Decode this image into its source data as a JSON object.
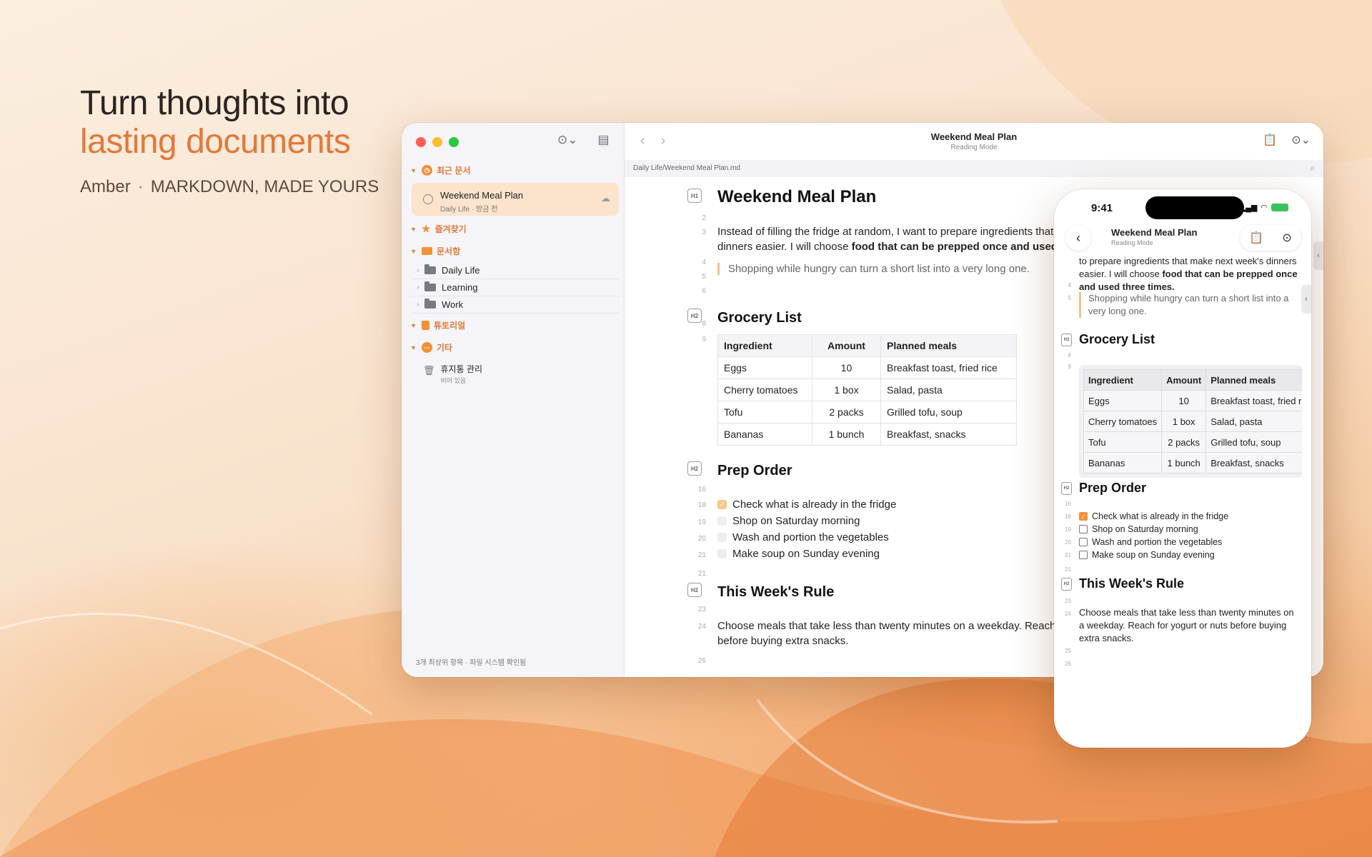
{
  "hero": {
    "line1": "Turn thoughts into",
    "line2": "lasting documents",
    "brand": "Amber",
    "sep": "·",
    "tagline": "MARKDOWN, MADE YOURS"
  },
  "sidebar": {
    "recent_label": "최근 문서",
    "recent_doc": {
      "title": "Weekend Meal Plan",
      "meta": "Daily Life · 방금 전"
    },
    "favorites_label": "즐겨찾기",
    "library_label": "문서함",
    "folders": [
      "Daily Life",
      "Learning",
      "Work"
    ],
    "tutorial_label": "튜토리얼",
    "other_label": "기타",
    "trash": {
      "title": "휴지통 관리",
      "sub": "비어 있음"
    },
    "footer": "3개 최상위 항목 · 파일 시스템 확인됨"
  },
  "toolbar": {
    "title": "Weekend Meal Plan",
    "mode": "Reading Mode"
  },
  "path": "Daily Life/Weekend Meal Plan.md",
  "doc": {
    "title": "Weekend Meal Plan",
    "intro_a": "Instead of filling the fridge at random, I want to prepare ingredients that make next week's dinners easier. I will choose ",
    "intro_bold": "food that can be prepped once and used three times.",
    "quote": "Shopping while hungry can turn a short list into a very long one.",
    "grocery_heading": "Grocery List",
    "table_headers": [
      "Ingredient",
      "Amount",
      "Planned meals"
    ],
    "table_rows": [
      [
        "Eggs",
        "10",
        "Breakfast toast, fried rice"
      ],
      [
        "Cherry tomatoes",
        "1 box",
        "Salad, pasta"
      ],
      [
        "Tofu",
        "2 packs",
        "Grilled tofu, soup"
      ],
      [
        "Bananas",
        "1 bunch",
        "Breakfast, snacks"
      ]
    ],
    "prep_heading": "Prep Order",
    "todos": [
      {
        "text": "Check what is already in the fridge",
        "done": true
      },
      {
        "text": "Shop on Saturday morning",
        "done": false
      },
      {
        "text": "Wash and portion the vegetables",
        "done": false
      },
      {
        "text": "Make soup on Sunday evening",
        "done": false
      }
    ],
    "rule_heading": "This Week's Rule",
    "rule_text": "Choose meals that take less than twenty minutes on a weekday. Reach for yogurt or nuts before buying extra snacks."
  },
  "line_numbers": {
    "h1": "H1",
    "h2": "H2",
    "l2": "2",
    "l3": "3",
    "l4": "4",
    "l5": "5",
    "l6": "6",
    "l8": "8",
    "l9": "9",
    "l16": "16",
    "l18": "18",
    "l19": "19",
    "l20": "20",
    "l21": "21",
    "l21b": "21",
    "l23": "23",
    "l24": "24",
    "l26": "26",
    "l25": "25"
  },
  "phone": {
    "time": "9:41",
    "intro_partial": "to prepare ingredients that make next week's dinners easier. I will choose ",
    "intro_bold": "food that can be prepped once and used three times."
  },
  "colors": {
    "accent": "#e0793a",
    "check": "#f29235"
  }
}
